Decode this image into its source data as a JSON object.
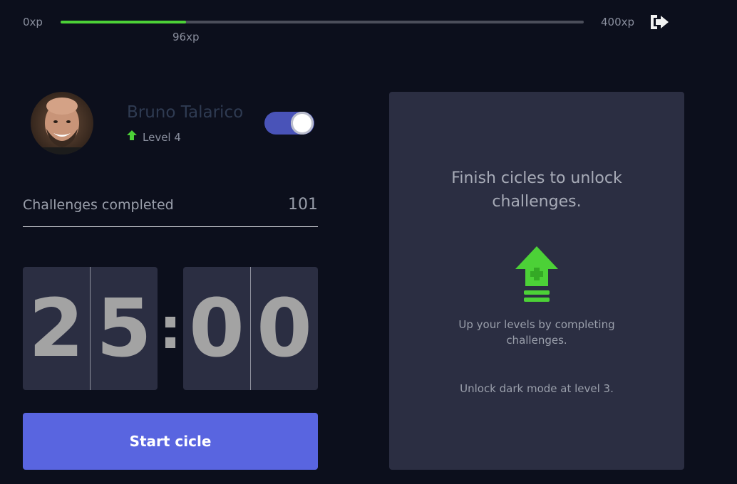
{
  "experience": {
    "min_label": "0xp",
    "max_label": "400xp",
    "current_label": "96xp",
    "current": 96,
    "max": 400,
    "bar_color": "#4cd137"
  },
  "header": {
    "logout_icon": "logout-icon"
  },
  "profile": {
    "name": "Bruno Talarico",
    "level_label": "Level 4",
    "level_icon": "level-up-arrow-icon",
    "dark_mode_toggle": "on"
  },
  "stats": {
    "challenges_label": "Challenges completed",
    "challenges_count": "101"
  },
  "countdown": {
    "minute_left": "2",
    "minute_right": "5",
    "separator": ":",
    "second_left": "0",
    "second_right": "0"
  },
  "actions": {
    "start_label": "Start cicle"
  },
  "challenge_panel": {
    "title": "Finish cicles to unlock challenges.",
    "icon": "level-up-icon",
    "hint": "Up your levels by completing challenges.",
    "unlock_text": "Unlock dark mode at level 3."
  },
  "colors": {
    "background": "#0c0f1c",
    "panel": "#2b2e42",
    "accent": "#5965e0",
    "green": "#4cd137",
    "toggle": "#4953b8"
  }
}
